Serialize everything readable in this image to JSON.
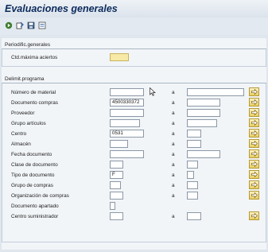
{
  "window": {
    "title": "Evaluaciones generales"
  },
  "toolbar": {
    "buttons": [
      {
        "name": "execute-icon"
      },
      {
        "name": "get-variant-icon"
      },
      {
        "name": "save-variant-icon"
      },
      {
        "name": "selection-options-icon"
      }
    ]
  },
  "periodific": {
    "header": "Periodific.generales",
    "max_hits_label": "Ctd.máxima aciertos",
    "max_hits_value": ""
  },
  "delimit": {
    "header": "Delimit.programa",
    "to_label": "a",
    "rows": [
      {
        "label": "Número de material",
        "from": "",
        "to": ""
      },
      {
        "label": "Documento compras",
        "from": "4500330372",
        "to": ""
      },
      {
        "label": "Proveedor",
        "from": "",
        "to": ""
      },
      {
        "label": "Grupo artículos",
        "from": "",
        "to": ""
      },
      {
        "label": "Centro",
        "from": "0531",
        "to": ""
      },
      {
        "label": "Almacén",
        "from": "",
        "to": ""
      },
      {
        "label": "Fecha documento",
        "from": "",
        "to": ""
      },
      {
        "label": "Clase de documento",
        "from": "",
        "to": ""
      },
      {
        "label": "Tipo de documento",
        "from": "F",
        "to": ""
      },
      {
        "label": "Grupo de compras",
        "from": "",
        "to": ""
      },
      {
        "label": "Organización de compras",
        "from": "",
        "to": ""
      },
      {
        "label": "Documento apartado",
        "from": ""
      },
      {
        "label": "Centro suministrador",
        "from": "",
        "to": ""
      }
    ]
  },
  "colors": {
    "background": "#dfe6ee",
    "title": "#0b2a5c",
    "required_field": "#f7e9a7",
    "multiple_selection_button": "#e8cf62"
  }
}
